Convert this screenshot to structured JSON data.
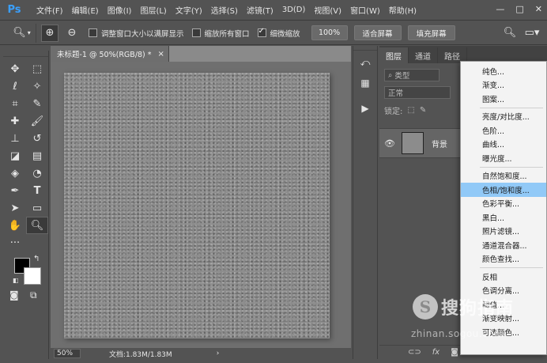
{
  "app": {
    "logo": "Ps"
  },
  "menu": [
    "文件(F)",
    "编辑(E)",
    "图像(I)",
    "图层(L)",
    "文字(Y)",
    "选择(S)",
    "滤镜(T)",
    "3D(D)",
    "视图(V)",
    "窗口(W)",
    "帮助(H)"
  ],
  "window_controls": {
    "minimize": "—",
    "maximize": "□",
    "close": "✕"
  },
  "options": {
    "tool_icon": "zoom-icon",
    "chk_resize": "调整窗口大小以满屏显示",
    "chk_resize_on": false,
    "chk_zoom_all": "缩放所有窗口",
    "chk_zoom_all_on": false,
    "chk_scrubby": "细微缩放",
    "chk_scrubby_on": true,
    "btn_100": "100%",
    "btn_fit": "适合屏幕",
    "btn_fill": "填充屏幕"
  },
  "document": {
    "tab_title": "未标题-1 @ 50%(RGB/8) *",
    "tab_close": "×",
    "zoom": "50%",
    "doc_info": "文档:1.83M/1.83M",
    "status_arrow": "›"
  },
  "layers_panel": {
    "tabs": [
      "图层",
      "通道",
      "路径"
    ],
    "filter_label": "类型",
    "blend_mode": "正常",
    "lock_label": "锁定:",
    "layer_name": "背景"
  },
  "adjustment_menu": {
    "group1": [
      "纯色...",
      "渐变...",
      "图案..."
    ],
    "group2": [
      "亮度/对比度...",
      "色阶...",
      "曲线...",
      "曝光度..."
    ],
    "group3": [
      "自然饱和度...",
      "色相/饱和度...",
      "色彩平衡...",
      "黑白...",
      "照片滤镜...",
      "通道混合器...",
      "颜色查找..."
    ],
    "group4": [
      "反相",
      "色调分离...",
      "阈值...",
      "渐变映射...",
      "可选颜色..."
    ],
    "highlighted": "色相/饱和度..."
  },
  "watermark": {
    "glyph": "S",
    "word": "搜狗指南",
    "url": "zhinan.sogou.com"
  },
  "colors": {
    "foreground": "#000000",
    "background": "#ffffff",
    "menu_hover": "#91c9f7",
    "ps_blue": "#3aa0ff"
  }
}
